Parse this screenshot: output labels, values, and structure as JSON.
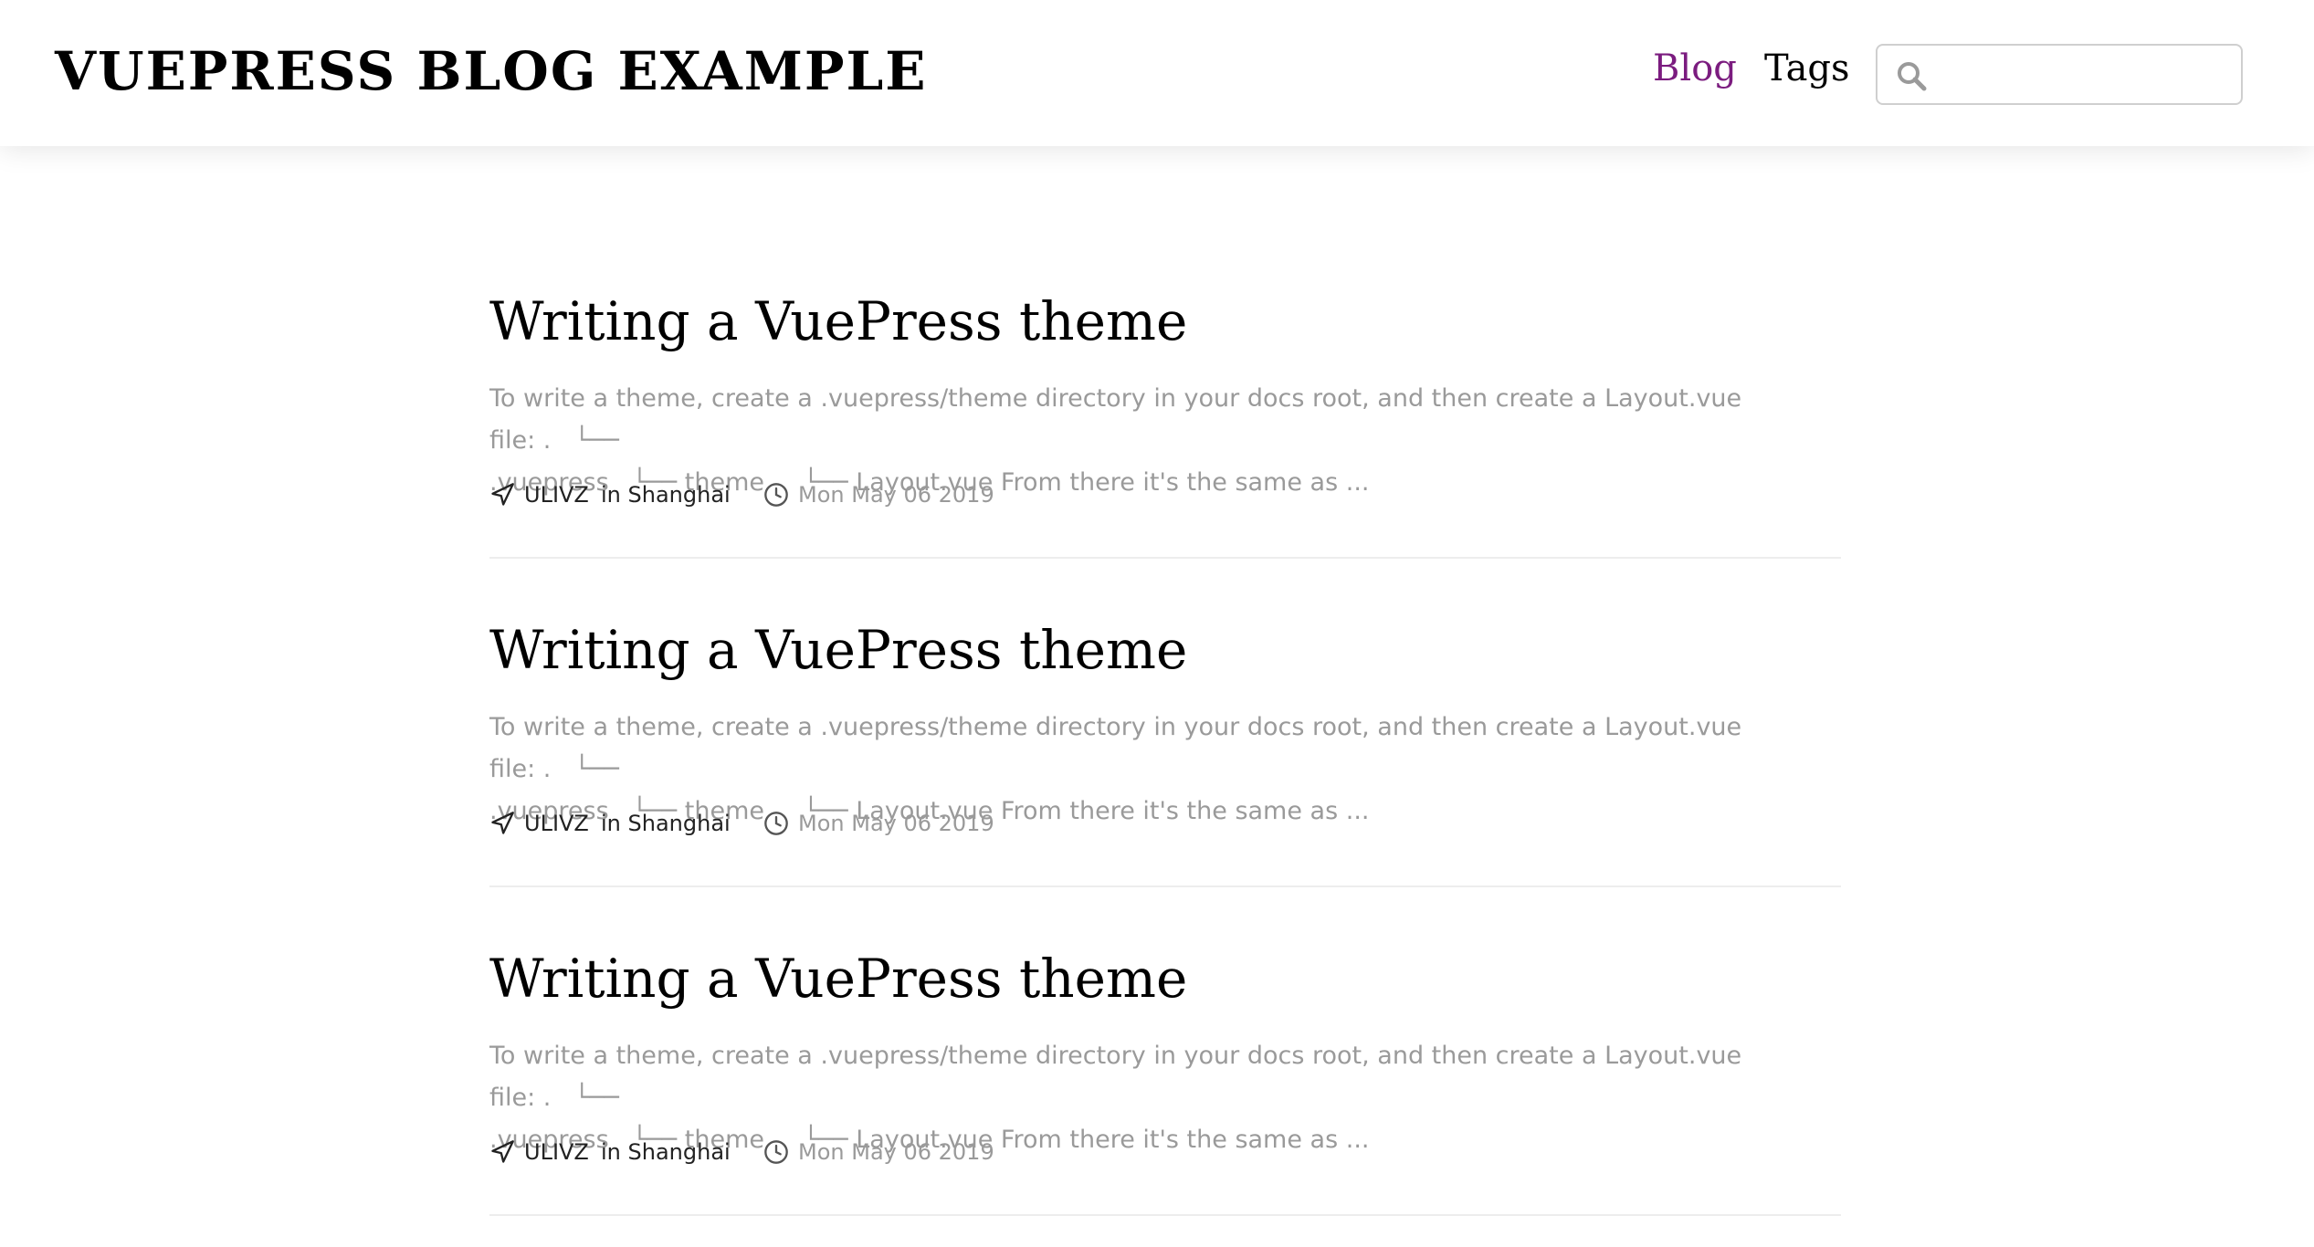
{
  "header": {
    "site_title": "VUEPRESS BLOG EXAMPLE",
    "nav": {
      "blog": "Blog",
      "tags": "Tags"
    },
    "search": {
      "value": "",
      "placeholder": ""
    },
    "active_nav_color": "#7b1c7f"
  },
  "posts": [
    {
      "title": "Writing a VuePress theme",
      "summary": "To write a theme, create a .vuepress/theme directory in your docs root, and then create a Layout.vue file: .   └──\n.vuepress   └── theme     └── Layout.vue From there it's the same as ...",
      "author": "ULIVZ",
      "location": "in Shanghai",
      "date": "Mon May 06 2019"
    },
    {
      "title": "Writing a VuePress theme",
      "summary": "To write a theme, create a .vuepress/theme directory in your docs root, and then create a Layout.vue file: .   └──\n.vuepress   └── theme     └── Layout.vue From there it's the same as ...",
      "author": "ULIVZ",
      "location": "in Shanghai",
      "date": "Mon May 06 2019"
    },
    {
      "title": "Writing a VuePress theme",
      "summary": "To write a theme, create a .vuepress/theme directory in your docs root, and then create a Layout.vue file: .   └──\n.vuepress   └── theme     └── Layout.vue From there it's the same as ...",
      "author": "ULIVZ",
      "location": "in Shanghai",
      "date": "Mon May 06 2019"
    }
  ]
}
